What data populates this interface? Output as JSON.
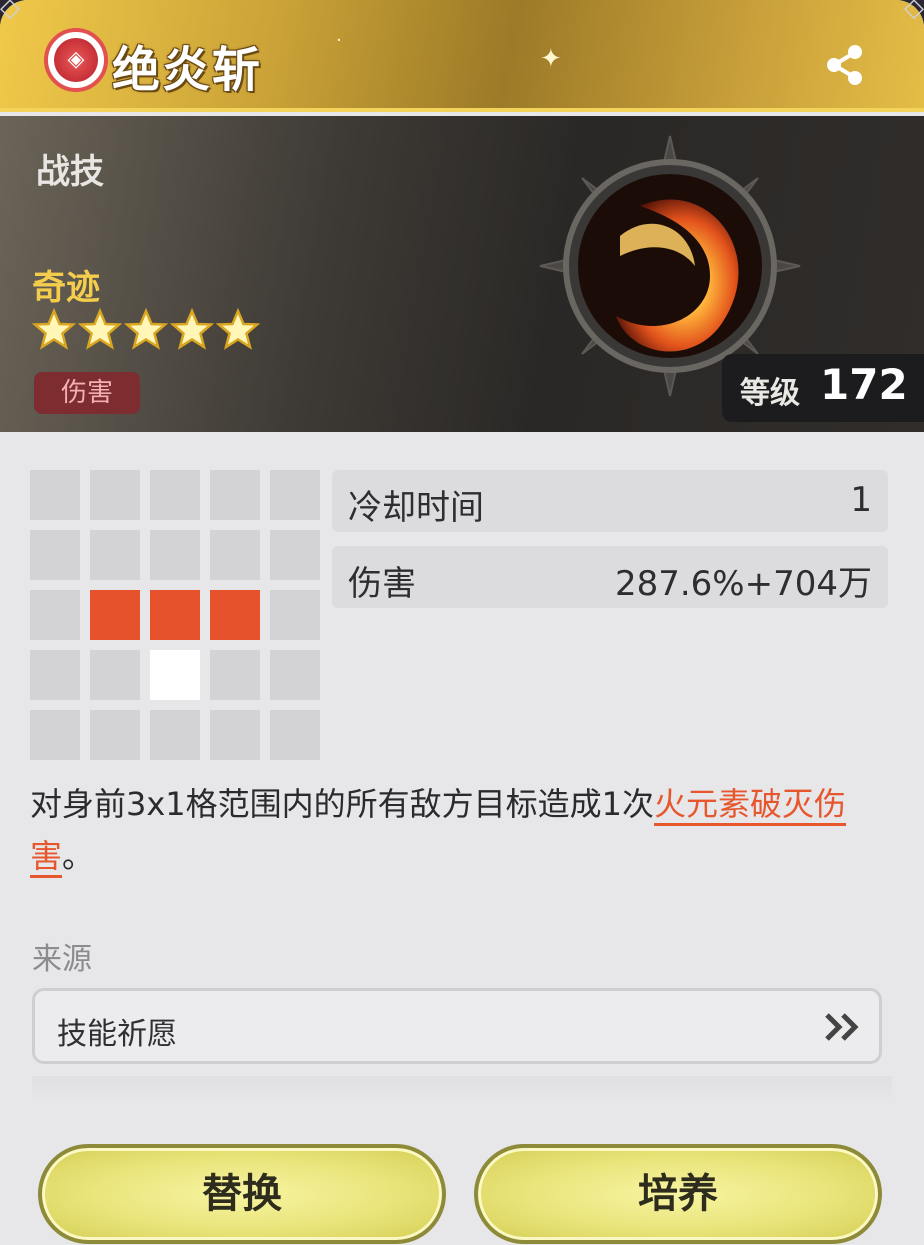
{
  "header": {
    "title": "绝炎斩",
    "emblem_icon": "faction-emblem-icon",
    "share_icon": "share-icon"
  },
  "banner": {
    "type": "战技",
    "rarity": "奇迹",
    "stars": 5,
    "tag": "伤害",
    "level_label": "等级",
    "level_value": "172",
    "skill_icon": "fire-slash-icon"
  },
  "range_grid": {
    "rows": 5,
    "cols": 5,
    "hit_cells": [
      [
        2,
        1
      ],
      [
        2,
        2
      ],
      [
        2,
        3
      ]
    ],
    "self_cell": [
      3,
      2
    ]
  },
  "stats": [
    {
      "label": "冷却时间",
      "value": "1"
    },
    {
      "label": "伤害",
      "value": "287.6%+704万"
    }
  ],
  "description": {
    "text": "对身前3x1格范围内的所有敌方目标造成1次",
    "highlight": "火元素破灭伤害",
    "end": "。"
  },
  "source": {
    "label": "来源",
    "item": "技能祈愿"
  },
  "buttons": {
    "replace": "替换",
    "develop": "培养"
  },
  "colors": {
    "accent_gold": "#f0c94a",
    "hit_cell": "#e5522b",
    "highlight_text": "#e7572e",
    "button_yellow": "#e9e47a"
  }
}
